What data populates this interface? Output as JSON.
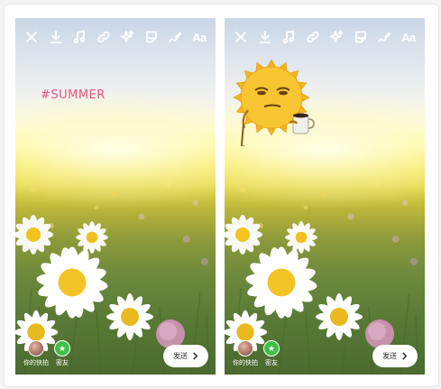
{
  "colors": {
    "hashtag": "#e7557f",
    "send_bg": "#ffffff",
    "friends_badge": "#3fbf4a",
    "icon": "#ffffff"
  },
  "toolbar": {
    "icons": [
      "close-icon",
      "download-icon",
      "music-icon",
      "link-icon",
      "sparkles-icon",
      "sticker-icon",
      "draw-icon"
    ],
    "text_button": "Aa"
  },
  "left_story": {
    "hashtag_text": "#SUMMER"
  },
  "right_story": {
    "sticker": "sun-with-coffee-sticker"
  },
  "bottom": {
    "story_label": "你的快拍",
    "friends_label": "密友",
    "send_label": "发送"
  }
}
